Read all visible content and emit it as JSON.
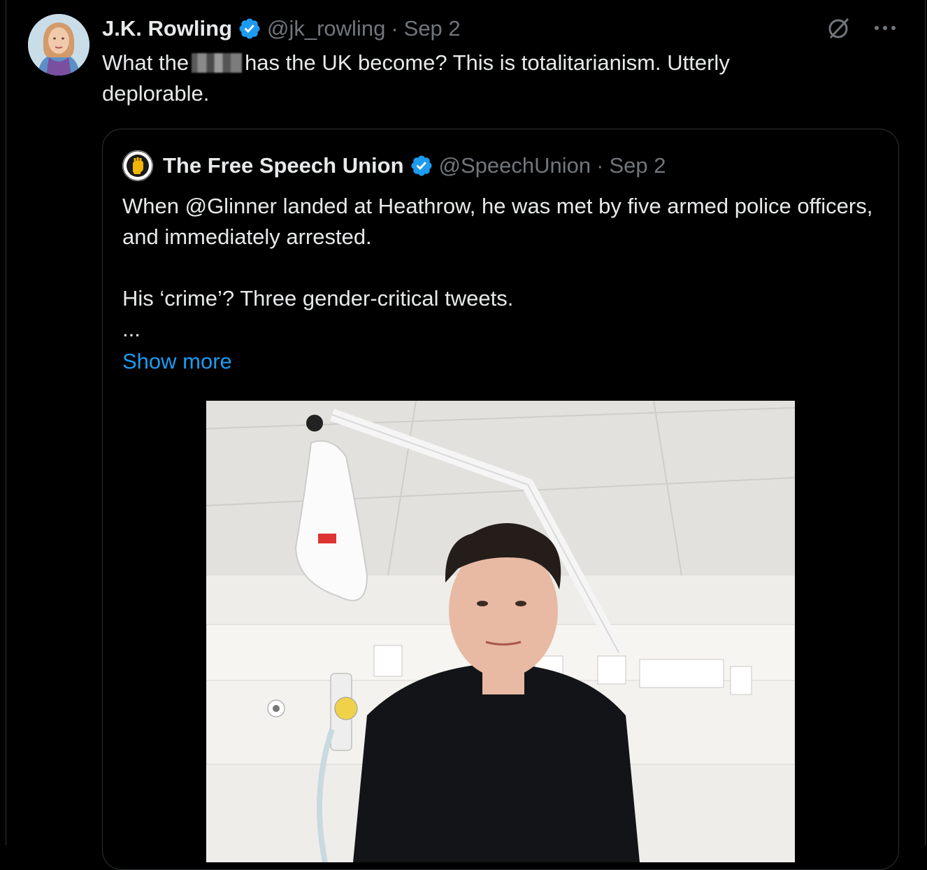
{
  "tweet": {
    "author_name": "J.K. Rowling",
    "handle": "@jk_rowling",
    "separator": "·",
    "date": "Sep 2",
    "text_before": "What the",
    "text_after": "has the UK become? This is totalitarianism. Utterly deplorable.",
    "icons": [
      "verified-badge-icon",
      "grok-icon",
      "more-icon"
    ]
  },
  "quoted_tweet": {
    "author_name": "The Free Speech Union",
    "handle": "@SpeechUnion",
    "separator": "·",
    "date": "Sep 2",
    "paragraph_1": "When @Glinner landed at Heathrow, he was met by five armed police officers, and immediately arrested.",
    "paragraph_2": "His ‘crime’? Three gender-critical tweets.",
    "ellipsis": "...",
    "show_more": "Show more"
  },
  "colors": {
    "background": "#000000",
    "text": "#e7e9ea",
    "muted": "#71767b",
    "link": "#1d9bf0",
    "border": "#2f3336",
    "verified": "#1d9bf0"
  }
}
